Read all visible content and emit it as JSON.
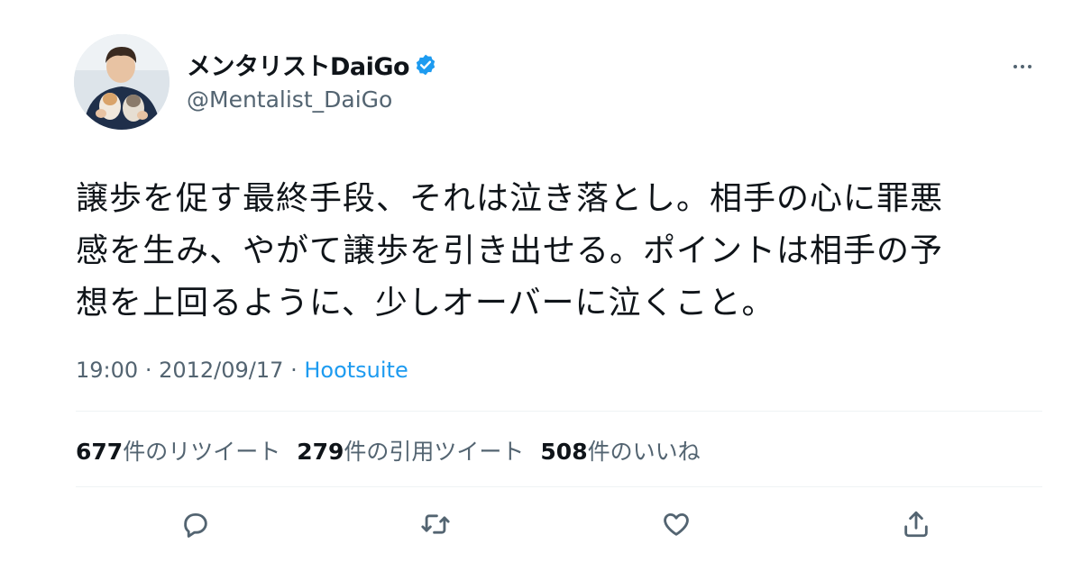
{
  "author": {
    "display_name": "メンタリストDaiGo",
    "handle": "@Mentalist_DaiGo",
    "verified": true,
    "verified_color": "#1d9bf0"
  },
  "tweet": {
    "text_lines": [
      "譲歩を促す最終手段、それは泣き落とし。相手の心に罪悪",
      "感を生み、やがて譲歩を引き出せる。ポイントは相手の予",
      "想を上回るように、少しオーバーに泣くこと。"
    ],
    "time": "19:00",
    "date": "2012/09/17",
    "separator": "·",
    "source": "Hootsuite"
  },
  "stats": {
    "retweets_count": "677",
    "retweets_label": "件のリツイート",
    "quotes_count": "279",
    "quotes_label": "件の引用ツイート",
    "likes_count": "508",
    "likes_label": "件のいいね"
  },
  "icons": {
    "more": "more-dots-icon",
    "reply": "reply-icon",
    "retweet": "retweet-icon",
    "like": "heart-icon",
    "share": "share-icon"
  },
  "colors": {
    "link": "#1d9bf0",
    "secondary_text": "#536471",
    "primary_text": "#0f1419"
  }
}
